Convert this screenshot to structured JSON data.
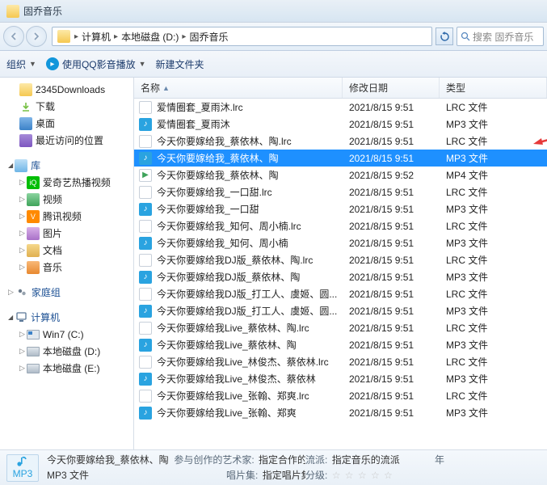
{
  "window": {
    "title": "固乔音乐"
  },
  "breadcrumbs": {
    "parts": [
      "计算机",
      "本地磁盘 (D:)",
      "固乔音乐"
    ]
  },
  "search": {
    "placeholder": "搜索 固乔音乐"
  },
  "toolbar": {
    "organize": "组织",
    "qq_play": "使用QQ影音播放",
    "new_folder": "新建文件夹"
  },
  "sidebar": {
    "fav": {
      "downloads_2345": "2345Downloads",
      "downloads": "下载",
      "desktop": "桌面",
      "recent": "最近访问的位置"
    },
    "lib": {
      "label": "库",
      "iqiyi": "爱奇艺热播视频",
      "video": "视频",
      "tencent": "腾讯视频",
      "picture": "图片",
      "document": "文档",
      "music": "音乐"
    },
    "homegroup": "家庭组",
    "computer": {
      "label": "计算机",
      "win7": "Win7 (C:)",
      "d": "本地磁盘 (D:)",
      "e": "本地磁盘 (E:)"
    }
  },
  "columns": {
    "name": "名称",
    "date": "修改日期",
    "type": "类型"
  },
  "file_types": {
    "lrc": "LRC 文件",
    "mp3": "MP3 文件",
    "mp4": "MP4 文件"
  },
  "files": [
    {
      "name": "爱情圈套_夏雨沐.lrc",
      "date": "2021/8/15 9:51",
      "type": "lrc"
    },
    {
      "name": "爱情圈套_夏雨沐",
      "date": "2021/8/15 9:51",
      "type": "mp3"
    },
    {
      "name": "今天你要嫁给我_蔡依林、陶.lrc",
      "date": "2021/8/15 9:51",
      "type": "lrc"
    },
    {
      "name": "今天你要嫁给我_蔡依林、陶",
      "date": "2021/8/15 9:51",
      "type": "mp3",
      "selected": true
    },
    {
      "name": "今天你要嫁给我_蔡依林、陶",
      "date": "2021/8/15 9:52",
      "type": "mp4"
    },
    {
      "name": "今天你要嫁给我_一口甜.lrc",
      "date": "2021/8/15 9:51",
      "type": "lrc"
    },
    {
      "name": "今天你要嫁给我_一口甜",
      "date": "2021/8/15 9:51",
      "type": "mp3"
    },
    {
      "name": "今天你要嫁给我_知何、周小楠.lrc",
      "date": "2021/8/15 9:51",
      "type": "lrc"
    },
    {
      "name": "今天你要嫁给我_知何、周小楠",
      "date": "2021/8/15 9:51",
      "type": "mp3"
    },
    {
      "name": "今天你要嫁给我DJ版_蔡依林、陶.lrc",
      "date": "2021/8/15 9:51",
      "type": "lrc"
    },
    {
      "name": "今天你要嫁给我DJ版_蔡依林、陶",
      "date": "2021/8/15 9:51",
      "type": "mp3"
    },
    {
      "name": "今天你要嫁给我DJ版_打工人、虞姬、圆...",
      "date": "2021/8/15 9:51",
      "type": "lrc"
    },
    {
      "name": "今天你要嫁给我DJ版_打工人、虞姬、圆...",
      "date": "2021/8/15 9:51",
      "type": "mp3"
    },
    {
      "name": "今天你要嫁给我Live_蔡依林、陶.lrc",
      "date": "2021/8/15 9:51",
      "type": "lrc"
    },
    {
      "name": "今天你要嫁给我Live_蔡依林、陶",
      "date": "2021/8/15 9:51",
      "type": "mp3"
    },
    {
      "name": "今天你要嫁给我Live_林俊杰、蔡依林.lrc",
      "date": "2021/8/15 9:51",
      "type": "lrc"
    },
    {
      "name": "今天你要嫁给我Live_林俊杰、蔡依林",
      "date": "2021/8/15 9:51",
      "type": "mp3"
    },
    {
      "name": "今天你要嫁给我Live_张翰、郑爽.lrc",
      "date": "2021/8/15 9:51",
      "type": "lrc"
    },
    {
      "name": "今天你要嫁给我Live_张翰、郑爽",
      "date": "2021/8/15 9:51",
      "type": "mp3"
    }
  ],
  "status": {
    "badge": "MP3",
    "name": "今天你要嫁给我_蔡依林、陶",
    "artists_lbl": "参与创作的艺术家:",
    "artists_val": "指定合作的艺术家",
    "type": "MP3 文件",
    "album_lbl": "唱片集:",
    "album_val": "指定唱片集",
    "genre_lbl": "流派:",
    "genre_val": "指定音乐的流派",
    "rating_lbl": "分级:",
    "year_lbl": "年"
  }
}
